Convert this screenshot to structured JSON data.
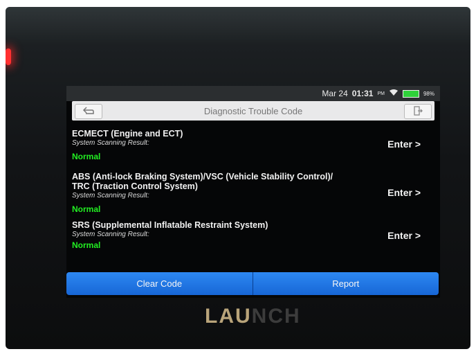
{
  "status_bar": {
    "date": "Mar 24",
    "time": "01:31",
    "ampm": "PM",
    "battery": "98%"
  },
  "header": {
    "title": "Diagnostic Trouble Code",
    "back_icon": "back-arrow-icon",
    "exit_icon": "exit-icon"
  },
  "systems": [
    {
      "name_lines": [
        "ECMECT (Engine and ECT)"
      ],
      "scan_label": "System Scanning Result:",
      "status": "Normal",
      "enter_label": "Enter >"
    },
    {
      "name_lines": [
        "ABS (Anti-lock Braking System)/VSC (Vehicle Stability Control)/",
        "TRC (Traction Control System)"
      ],
      "scan_label": "System Scanning Result:",
      "status": "Normal",
      "enter_label": "Enter >"
    },
    {
      "name_lines": [
        "SRS (Supplemental Inflatable Restraint System)"
      ],
      "scan_label": "System Scanning Result:",
      "status": "Normal",
      "enter_label": "Enter >"
    }
  ],
  "footer": {
    "clear_code_label": "Clear Code",
    "report_label": "Report"
  },
  "device": {
    "brand_part1": "LAU",
    "brand_part2": "NCH"
  },
  "colors": {
    "accent_blue": "#1f7ae6",
    "status_green": "#22ee22",
    "battery_green": "#2fd13a"
  }
}
